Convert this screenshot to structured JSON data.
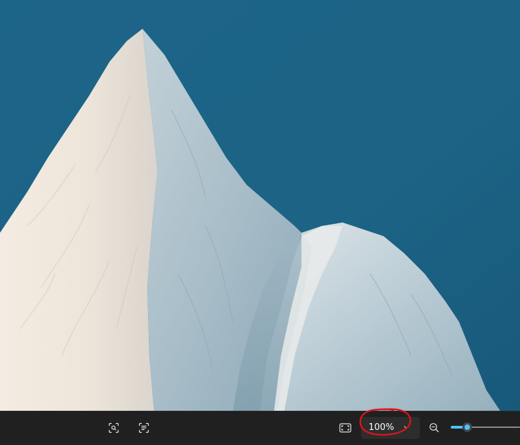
{
  "toolbar": {
    "zoom": {
      "value_label": "100%",
      "slider_fraction": 0.24
    },
    "icons": {
      "visual_search": "visual-search-icon",
      "text_recognition": "text-recognition-icon",
      "fit_to_window": "fit-to-window-icon",
      "zoom_out": "zoom-out-icon",
      "dropdown": "chevron-down-icon"
    },
    "colors": {
      "background": "#202020",
      "accent": "#4cc2ff",
      "annotation": "#d9141b"
    }
  },
  "image": {
    "sky_color": "#1d6387",
    "snow_color": "#e7ecef"
  }
}
